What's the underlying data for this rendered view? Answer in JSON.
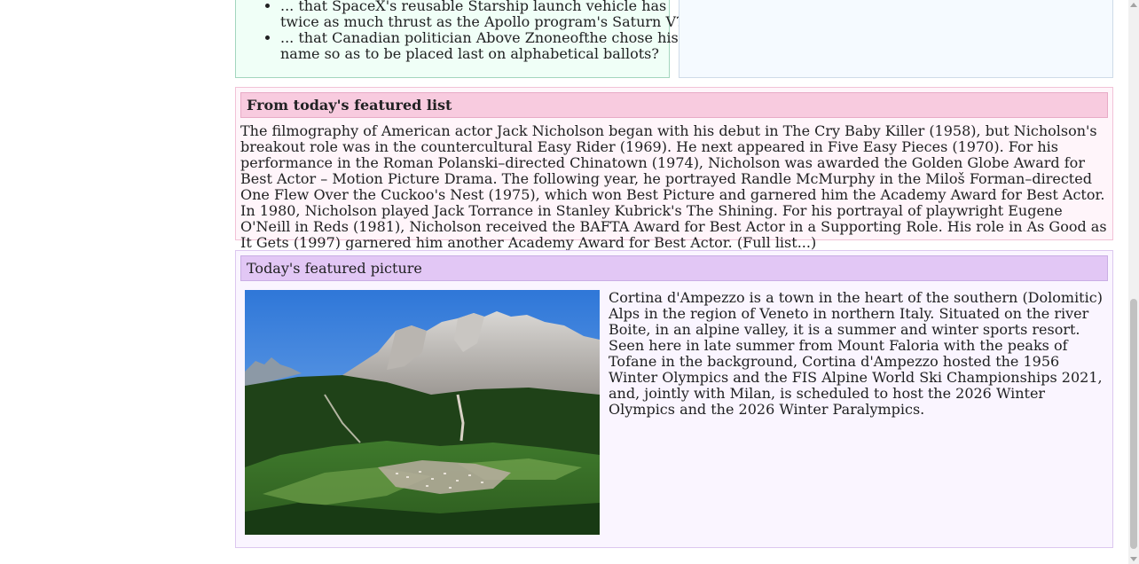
{
  "dyk": {
    "items": [
      "... that SpaceX's reusable Starship launch vehicle has twice as much thrust as the Apollo program's Saturn V?",
      "... that Canadian politician Above Znoneofthe chose his name so as to be placed last on alphabetical ballots?"
    ]
  },
  "featured_list": {
    "heading": "From today's featured list",
    "text": "The filmography of American actor Jack Nicholson began with his debut in The Cry Baby Killer (1958), but Nicholson's breakout role was in the countercultural Easy Rider (1969). He next appeared in Five Easy Pieces (1970). For his performance in the Roman Polanski–directed Chinatown (1974), Nicholson was awarded the Golden Globe Award for Best Actor – Motion Picture Drama. The following year, he portrayed Randle McMurphy in the Miloš Forman–directed One Flew Over the Cuckoo's Nest (1975), which won Best Picture and garnered him the Academy Award for Best Actor. In 1980, Nicholson played Jack Torrance in Stanley Kubrick's The Shining. For his portrayal of playwright Eugene O'Neill in Reds (1981), Nicholson received the BAFTA Award for Best Actor in a Supporting Role. His role in As Good as It Gets (1997) garnered him another Academy Award for Best Actor.",
    "full_list_link": "(Full list...)"
  },
  "featured_picture": {
    "heading": "Today's featured picture",
    "caption": "Cortina d'Ampezzo is a town in the heart of the southern (Dolomitic) Alps in the region of Veneto in northern Italy. Situated on the river Boite, in an alpine valley, it is a summer and winter sports resort. Seen here in late summer from Mount Faloria with the peaks of Tofane in the background, Cortina d'Ampezzo hosted the 1956 Winter Olympics and the FIS Alpine World Ski Championships 2021, and, jointly with Milan, is scheduled to host the 2026 Winter Olympics and the 2026 Winter Paralympics."
  },
  "colors": {
    "dyk_bg": "#f0fff7",
    "news_bg": "#f5faff",
    "list_header_bg": "#f8cbdf",
    "picture_header_bg": "#e2c7f5"
  }
}
